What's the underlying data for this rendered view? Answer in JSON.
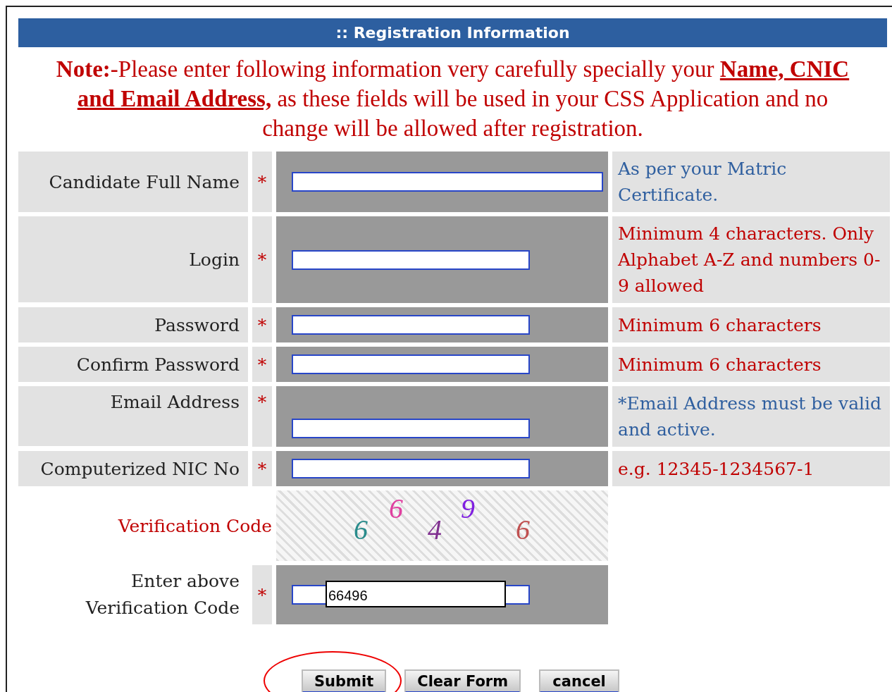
{
  "header": {
    "title": ":: Registration Information"
  },
  "note": {
    "lead": "Note:",
    "text": "-Please enter following information very carefully specially your ",
    "highlight": "Name, CNIC and Email Address,",
    "rest": " as these fields will be used in your CSS Application and no change will be allowed after registration."
  },
  "fields": [
    {
      "label": "Candidate Full Name",
      "required": "*",
      "kind": "wide",
      "hint": "As per your Matric Certificate.",
      "color": "#2f5f9f"
    },
    {
      "label": "Login",
      "required": "*",
      "kind": "short",
      "hint": "Minimum 4 characters. Only Alphabet A-Z and numbers 0-9 allowed",
      "color": "#c00000"
    },
    {
      "label": "Password",
      "required": "*",
      "kind": "short",
      "hint": "Minimum 6 characters",
      "color": "#c00000"
    },
    {
      "label": "Confirm Password",
      "required": "*",
      "kind": "short",
      "hint": "Minimum 6 characters",
      "color": "#c00000"
    },
    {
      "label": "Email Address",
      "required": "*",
      "kind": "short",
      "hint": "*Email Address must be valid and active.",
      "color": "#2f5f9f"
    },
    {
      "label": "Computerized NIC No",
      "required": "*",
      "kind": "short",
      "hint": "e.g. 12345-1234567-1",
      "color": "#c00000"
    }
  ],
  "captcha": {
    "label": "Verification Code",
    "chars": [
      {
        "text": "6",
        "color": "#2a8c8c"
      },
      {
        "text": "6",
        "color": "#e040a0"
      },
      {
        "text": "4",
        "color": "#803090"
      },
      {
        "text": "9",
        "color": "#8020e0"
      },
      {
        "text": "6",
        "color": "#c05050"
      }
    ]
  },
  "verification": {
    "label_line1": "Enter above",
    "label_line2": "Verification Code",
    "required": "*",
    "value": "66496"
  },
  "buttons": [
    {
      "label": "Submit",
      "highlighted": true
    },
    {
      "label": "Clear Form",
      "highlighted": false
    },
    {
      "label": "cancel",
      "highlighted": false
    }
  ]
}
